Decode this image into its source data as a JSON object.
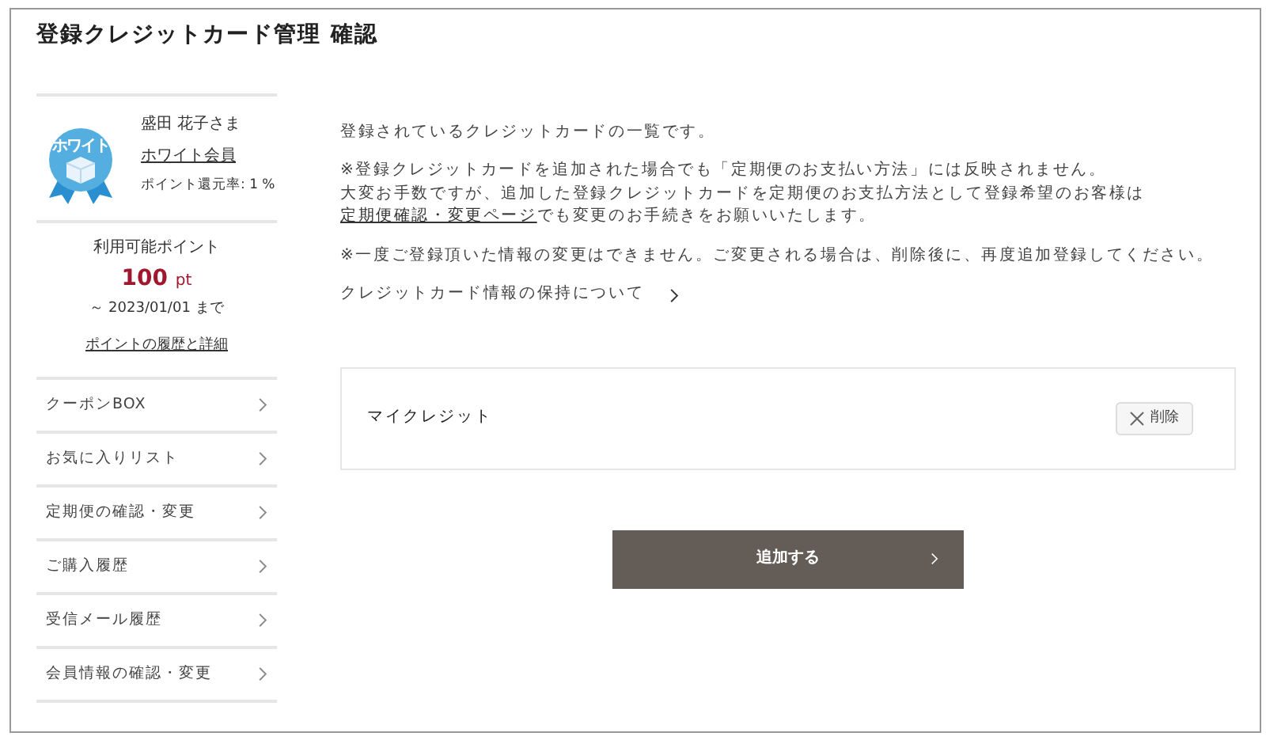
{
  "title": "登録クレジットカード管理 確認",
  "member": {
    "badge_label": "ホワイト",
    "name": "盛田 花子さま",
    "rank": "ホワイト会員",
    "rate": "ポイント還元率: 1 %"
  },
  "points": {
    "label": "利用可能ポイント",
    "value": "100",
    "unit": "pt",
    "expiry": "～ 2023/01/01 まで",
    "history_link": "ポイントの履歴と詳細"
  },
  "menu": [
    {
      "label": "クーポンBOX"
    },
    {
      "label": "お気に入りリスト"
    },
    {
      "label": "定期便の確認・変更"
    },
    {
      "label": "ご購入履歴"
    },
    {
      "label": "受信メール履歴"
    },
    {
      "label": "会員情報の確認・変更"
    }
  ],
  "intro": "登録されているクレジットカードの一覧です。",
  "note1": {
    "line1": "※登録クレジットカードを追加された場合でも「定期便のお支払い方法」には反映されません。",
    "before": "大変お手数ですが、追加した登録クレジットカードを定期便のお支払方法として登録希望のお客様は",
    "link": "定期便確認・変更ページ",
    "after": "でも変更のお手続きをお願いいたします。"
  },
  "note2": "※一度ご登録頂いた情報の変更はできません。ご変更される場合は、削除後に、再度追加登録してください。",
  "retention_link": "クレジットカード情報の保持について",
  "cards": [
    {
      "name": "マイクレジット",
      "delete_label": "削除"
    }
  ],
  "add_button": "追加する"
}
